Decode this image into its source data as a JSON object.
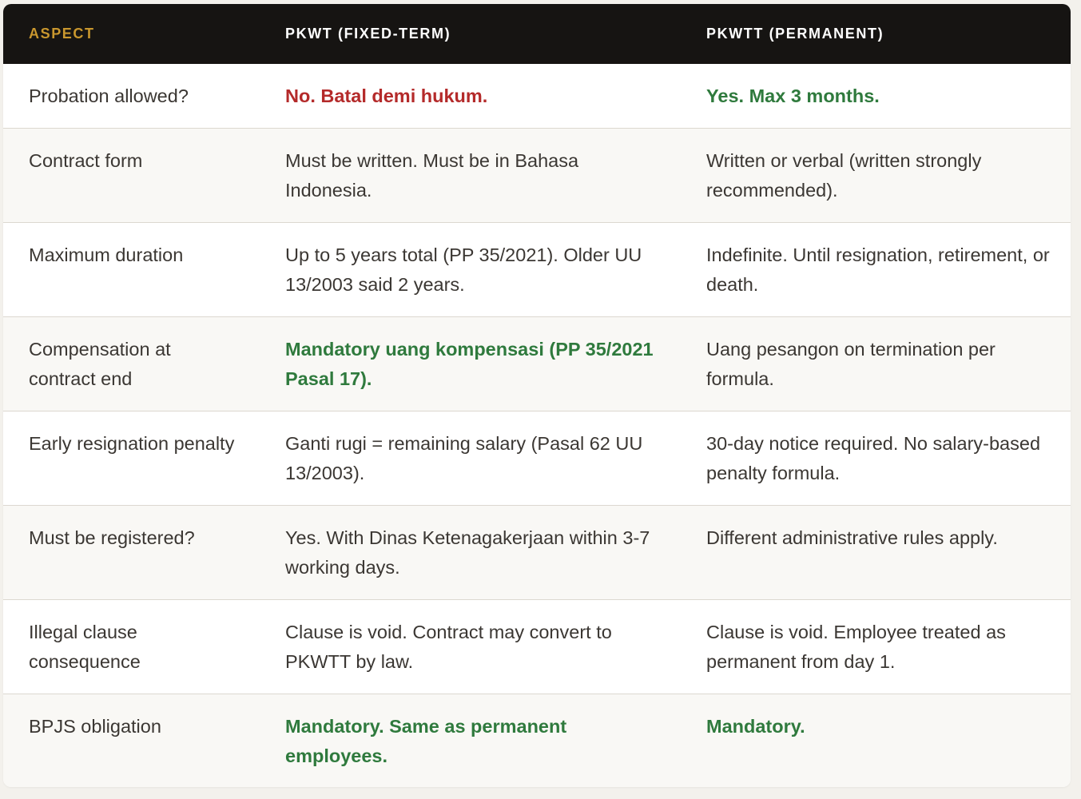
{
  "header": {
    "aspect": "ASPECT",
    "pkwt": "PKWT (FIXED-TERM)",
    "pkwtt": "PKWTT (PERMANENT)"
  },
  "colors": {
    "header_bg": "#161412",
    "aspect_header": "#c9972e",
    "negative": "#b42a2a",
    "positive": "#2f7a3d"
  },
  "rows": [
    {
      "aspect": "Probation allowed?",
      "pkwt": "No. Batal demi hukum.",
      "pkwtt": "Yes. Max 3 months."
    },
    {
      "aspect": "Contract form",
      "pkwt": "Must be written. Must be in Bahasa Indonesia.",
      "pkwtt": "Written or verbal (written strongly recommended)."
    },
    {
      "aspect": "Maximum duration",
      "pkwt": "Up to 5 years total (PP 35/2021). Older UU 13/2003 said 2 years.",
      "pkwtt": "Indefinite. Until resignation, retirement, or death."
    },
    {
      "aspect": "Compensation at contract end",
      "pkwt": "Mandatory uang kompensasi (PP 35/2021 Pasal 17).",
      "pkwtt": "Uang pesangon on termination per formula."
    },
    {
      "aspect": "Early resignation penalty",
      "pkwt": "Ganti rugi = remaining salary (Pasal 62 UU 13/2003).",
      "pkwtt": "30-day notice required. No salary-based penalty formula."
    },
    {
      "aspect": "Must be registered?",
      "pkwt": "Yes. With Dinas Ketenagakerjaan within 3-7 working days.",
      "pkwtt": "Different administrative rules apply."
    },
    {
      "aspect": "Illegal clause consequence",
      "pkwt": "Clause is void. Contract may convert to PKWTT by law.",
      "pkwtt": "Clause is void. Employee treated as permanent from day 1."
    },
    {
      "aspect": "BPJS obligation",
      "pkwt": "Mandatory. Same as permanent employees.",
      "pkwtt": "Mandatory."
    }
  ]
}
